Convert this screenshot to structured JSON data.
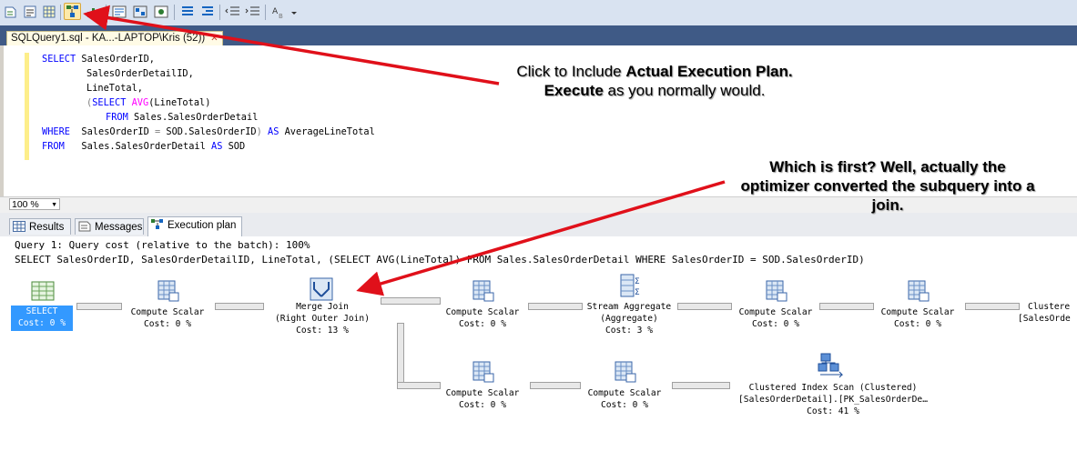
{
  "tab": {
    "title": "SQLQuery1.sql - KA...-LAPTOP\\Kris (52))",
    "close": "✕"
  },
  "sql": {
    "l1a": "SELECT",
    "l1b": " SalesOrderID,",
    "l2": "SalesOrderDetailID,",
    "l3": "LineTotal,",
    "l4a": "(",
    "l4b": "SELECT",
    "l4c": " ",
    "l4d": "AVG",
    "l4e": "(LineTotal)",
    "l5a": "FROM",
    "l5b": " Sales.SalesOrderDetail",
    "l6a": "WHERE",
    "l6b": "  SalesOrderID ",
    "l6c": "=",
    "l6d": " SOD.SalesOrderID",
    "l6e": ")",
    "l6f": " AS",
    "l6g": " AverageLineTotal",
    "l7a": "FROM",
    "l7b": "   Sales.SalesOrderDetail ",
    "l7c": "AS",
    "l7d": " SOD"
  },
  "zoom": "100 %",
  "result_tabs": [
    "Results",
    "Messages",
    "Execution plan"
  ],
  "query_header": "Query 1: Query cost (relative to the batch): 100%",
  "query_text": "SELECT SalesOrderID, SalesOrderDetailID, LineTotal, (SELECT AVG(LineTotal) FROM Sales.SalesOrderDetail WHERE SalesOrderID = SOD.SalesOrderID)",
  "operators": {
    "select": {
      "name": "SELECT",
      "cost": "Cost: 0 %"
    },
    "cs1": {
      "name": "Compute Scalar",
      "cost": "Cost: 0 %"
    },
    "merge": {
      "name": "Merge Join",
      "sub": "(Right Outer Join)",
      "cost": "Cost: 13 %"
    },
    "cs2": {
      "name": "Compute Scalar",
      "cost": "Cost: 0 %"
    },
    "agg": {
      "name": "Stream Aggregate",
      "sub": "(Aggregate)",
      "cost": "Cost: 3 %"
    },
    "cs3": {
      "name": "Compute Scalar",
      "cost": "Cost: 0 %"
    },
    "cs4": {
      "name": "Compute Scalar",
      "cost": "Cost: 0 %"
    },
    "scan_top": {
      "name": "Clustere",
      "sub": "[SalesOrde"
    },
    "cs5": {
      "name": "Compute Scalar",
      "cost": "Cost: 0 %"
    },
    "cs6": {
      "name": "Compute Scalar",
      "cost": "Cost: 0 %"
    },
    "scan": {
      "name": "Clustered Index Scan (Clustered)",
      "sub": "[SalesOrderDetail].[PK_SalesOrderDe…",
      "cost": "Cost: 41 %"
    }
  },
  "annotations": {
    "note1_a": "Click to Include ",
    "note1_b": "Actual Execution Plan.",
    "note1_c": "Execute",
    "note1_d": " as you normally would.",
    "note2_a": "Which is first?  Well, actually the",
    "note2_b": "optimizer converted the subquery into a",
    "note2_c": "join."
  },
  "colors": {
    "accent": "#3399ff",
    "arrow": "#e0101a",
    "tabstrip": "#3f5a86"
  }
}
